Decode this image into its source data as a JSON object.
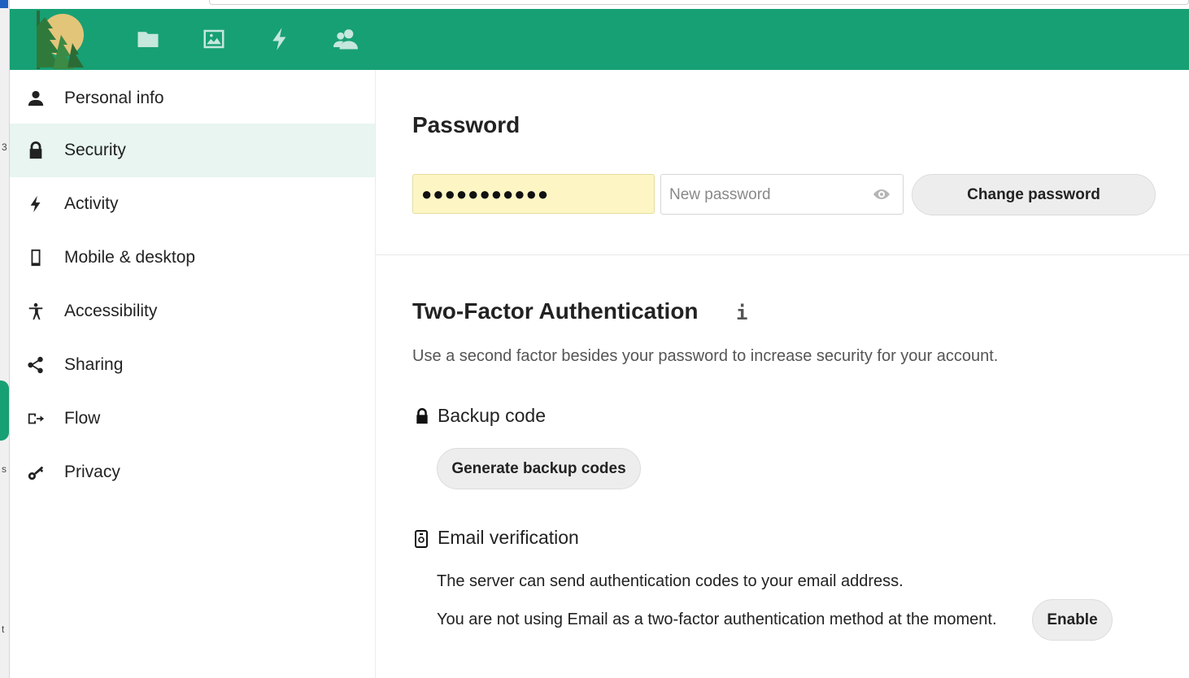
{
  "header": {
    "apps": [
      {
        "icon": "folder-icon",
        "name": "files"
      },
      {
        "icon": "image-icon",
        "name": "photos"
      },
      {
        "icon": "lightning-icon",
        "name": "activity"
      },
      {
        "icon": "contacts-icon",
        "name": "contacts"
      }
    ]
  },
  "sidebar": {
    "items": [
      {
        "label": "Personal info",
        "icon": "person-icon"
      },
      {
        "label": "Security",
        "icon": "lock-icon",
        "active": true
      },
      {
        "label": "Activity",
        "icon": "lightning-icon"
      },
      {
        "label": "Mobile & desktop",
        "icon": "phone-icon"
      },
      {
        "label": "Accessibility",
        "icon": "accessibility-icon"
      },
      {
        "label": "Sharing",
        "icon": "share-icon"
      },
      {
        "label": "Flow",
        "icon": "flow-icon"
      },
      {
        "label": "Privacy",
        "icon": "key-icon"
      }
    ]
  },
  "password": {
    "title": "Password",
    "current_value": "●●●●●●●●●●●",
    "new_placeholder": "New password",
    "change_button": "Change password"
  },
  "twofactor": {
    "title": "Two-Factor Authentication",
    "info_glyph": "i",
    "description": "Use a second factor besides your password to increase security for your account.",
    "backup": {
      "title": "Backup code",
      "button": "Generate backup codes"
    },
    "email": {
      "title": "Email verification",
      "line1": "The server can send authentication codes to your email address.",
      "line2": "You are not using Email as a two-factor authentication method at the moment.",
      "enable_button": "Enable"
    }
  },
  "colors": {
    "header": "#17a074",
    "active_item_bg": "#e8f5f0",
    "autofill_bg": "#fdf6c4"
  },
  "edge_window": {
    "fragments": [
      "3",
      "s",
      "t"
    ]
  }
}
